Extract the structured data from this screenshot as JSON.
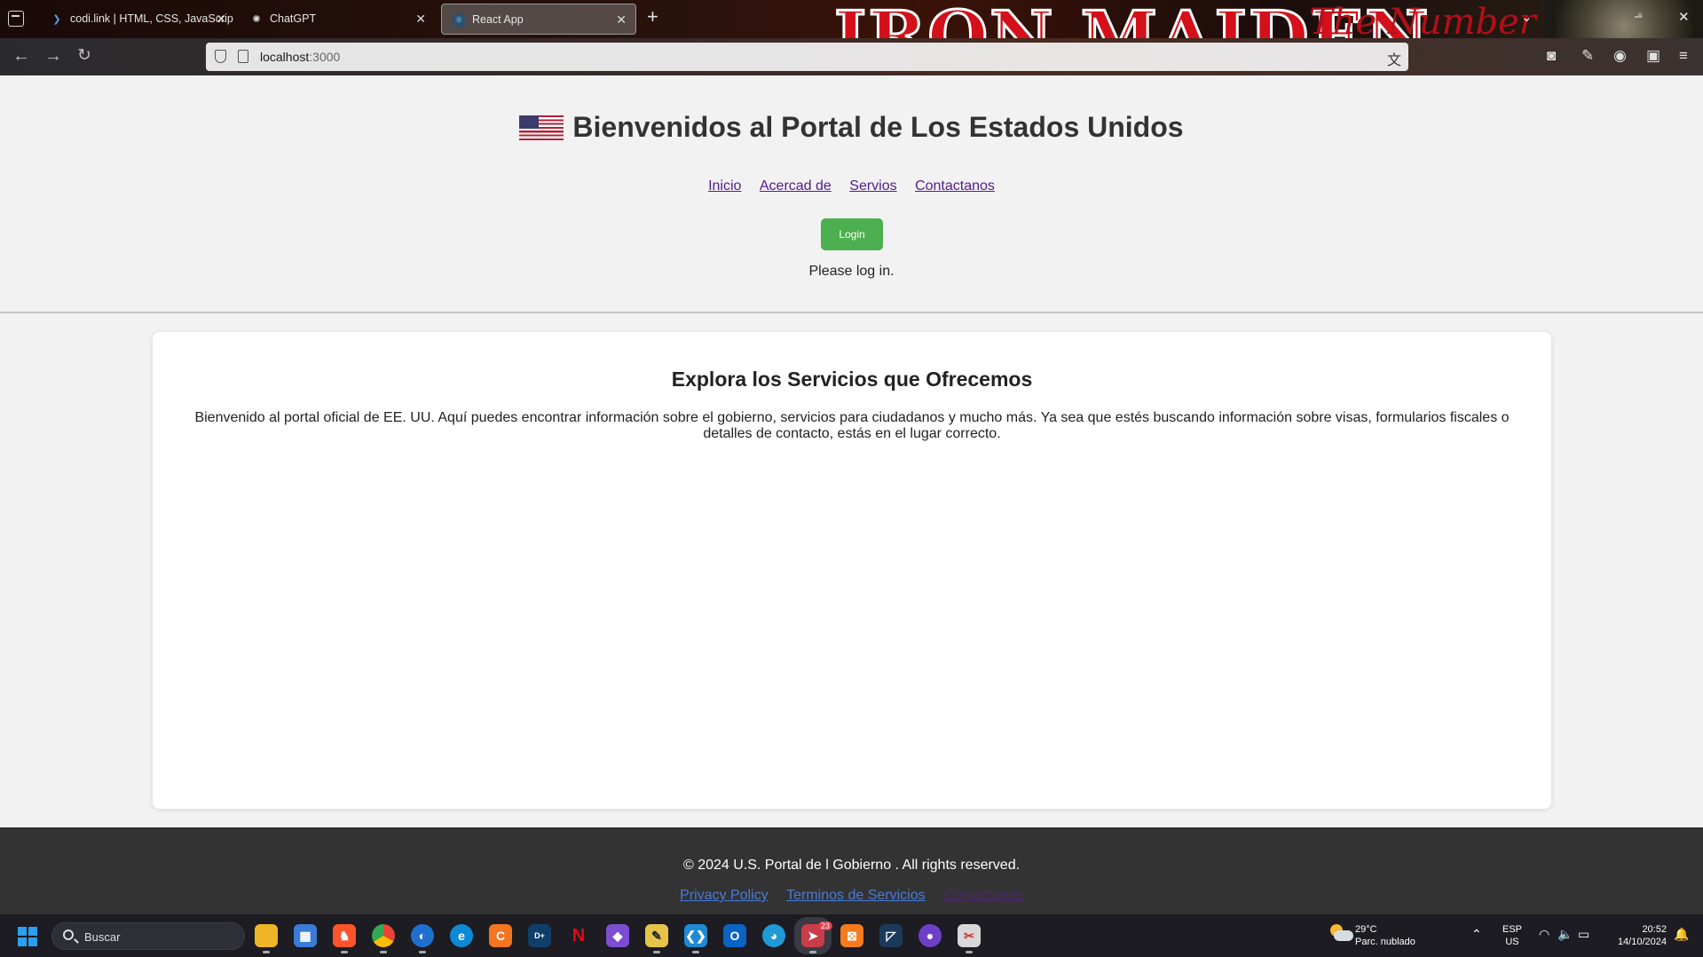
{
  "browser": {
    "tabs": [
      {
        "title": "codi.link | HTML, CSS, JavaScrip",
        "favicon": "codilink-icon",
        "active": false
      },
      {
        "title": "ChatGPT",
        "favicon": "chatgpt-icon",
        "active": false
      },
      {
        "title": "React App",
        "favicon": "react-icon",
        "active": true
      }
    ],
    "theme_banner": {
      "line1": "IRON MAIDEN",
      "line2": "The Number of the Beast"
    },
    "url_host": "localhost",
    "url_port": ":3000"
  },
  "page": {
    "title": "Bienvenidos al Portal de Los Estados Unidos",
    "flag": "us-flag-icon",
    "nav": [
      "Inicio",
      "Acercad de",
      "Servios",
      "Contactanos"
    ],
    "login_label": "Login",
    "status": "Please log in.",
    "section_title": "Explora los Servicios que Ofrecemos",
    "section_text": "Bienvenido al portal oficial de EE. UU. Aquí puedes encontrar información sobre el gobierno, servicios para ciudadanos y mucho más. Ya sea que estés buscando información sobre visas, formularios fiscales o detalles de contacto, estás en el lugar correcto.",
    "footer_copy": "© 2024 U.S. Portal de l Gobierno . All rights reserved.",
    "footer_links": [
      "Privacy Policy",
      "Terminos de Servicios",
      "Contactanos"
    ],
    "colors": {
      "login_bg": "#4caf50",
      "footer_bg": "#333333",
      "link_visited": "#551a8b"
    }
  },
  "taskbar": {
    "search_placeholder": "Buscar",
    "apps": [
      "file-explorer-icon",
      "microsoft-store-icon",
      "brave-icon",
      "chrome-dev-icon",
      "firefox-icon",
      "edge-icon",
      "crunchyroll-icon",
      "disney-plus-icon",
      "netflix-icon",
      "visual-studio-icon",
      "paint-icon",
      "vscode-icon",
      "outlook-icon",
      "app-icon",
      "telegram-icon",
      "xampp-icon",
      "mysql-workbench-icon",
      "github-desktop-icon",
      "snipping-tool-icon"
    ],
    "telegram_badge": "23",
    "weather_temp": "29°C",
    "weather_desc": "Parc. nublado",
    "lang": "ESP",
    "layout": "US",
    "time": "20:52",
    "date": "14/10/2024"
  }
}
